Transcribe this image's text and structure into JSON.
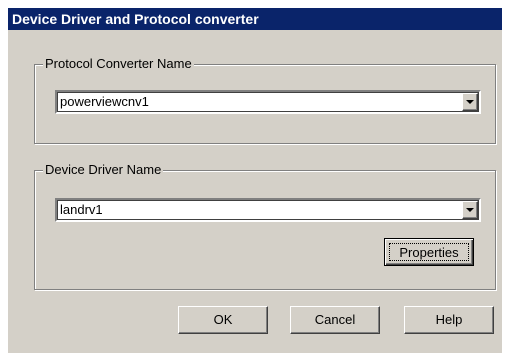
{
  "dialog": {
    "title": "Device Driver and Protocol converter"
  },
  "protocol_group": {
    "legend": "Protocol Converter Name",
    "selected_value": "powerviewcnv1"
  },
  "driver_group": {
    "legend": "Device Driver Name",
    "selected_value": "landrv1",
    "properties_label": "Properties"
  },
  "buttons": {
    "ok_label": "OK",
    "cancel_label": "Cancel",
    "help_label": "Help"
  },
  "icons": {
    "dropdown": "chevron-down-icon"
  },
  "colors": {
    "titlebar": "#0a246a",
    "dialog_face": "#d4d0c8"
  }
}
